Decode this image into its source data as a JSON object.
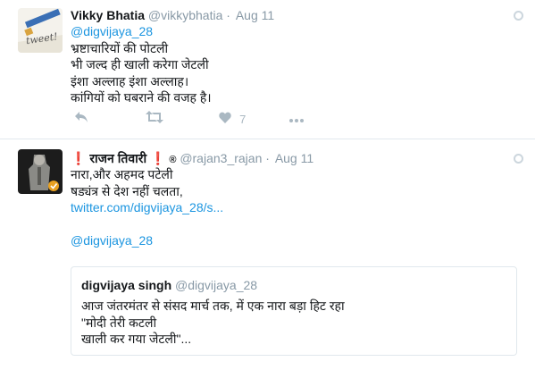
{
  "tweet1": {
    "name": "Vikky Bhatia",
    "handle": "@vikkybhatia",
    "separator": "·",
    "time": "Aug 11",
    "avatar_text": "tweet!",
    "mention": "@digvijaya_28",
    "lines": [
      "भ्रष्टाचारियों की पोटली",
      "भी जल्द ही खाली करेगा जेटली",
      "इंशा अल्लाह इंशा अल्लाह।",
      "कांगियों को घबराने की वजह है।"
    ],
    "like_count": "7"
  },
  "tweet2": {
    "name": "❗ राजन तिवारी ❗",
    "registered": "®",
    "handle": "@rajan3_rajan",
    "separator": "·",
    "time": "Aug 11",
    "lines": [
      "नारा,और अहमद पटेली",
      "षड्यंत्र से देश नहीं चलता,"
    ],
    "link": "twitter.com/digvijaya_28/s...",
    "mention": "@digvijaya_28",
    "quote": {
      "name": "digvijaya singh",
      "handle": "@digvijaya_28",
      "lines": [
        "आज जंतरमंतर से संसद मार्च तक, में एक नारा बड़ा हिट रहा",
        "\"मोदी तेरी कटली",
        "खाली कर गया जेटली\"..."
      ]
    }
  },
  "colors": {
    "link": "#1b95e0",
    "muted": "#8899a6",
    "icon": "#aab8c2",
    "divider": "#e1e8ed"
  },
  "icons": [
    "reply-icon",
    "retweet-icon",
    "like-icon",
    "more-icon",
    "caret-icon",
    "verified-icon"
  ]
}
